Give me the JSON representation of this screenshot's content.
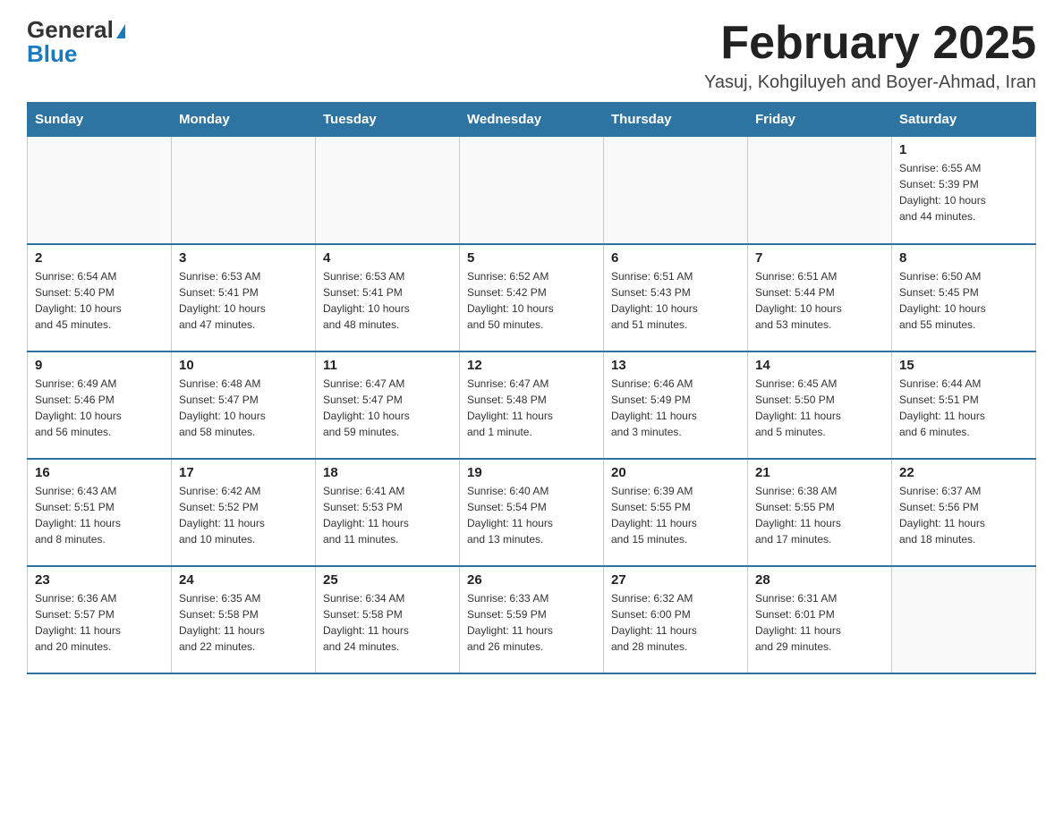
{
  "logo": {
    "general": "General",
    "blue": "Blue"
  },
  "title": "February 2025",
  "subtitle": "Yasuj, Kohgiluyeh and Boyer-Ahmad, Iran",
  "days_header": [
    "Sunday",
    "Monday",
    "Tuesday",
    "Wednesday",
    "Thursday",
    "Friday",
    "Saturday"
  ],
  "weeks": [
    [
      {
        "num": "",
        "info": ""
      },
      {
        "num": "",
        "info": ""
      },
      {
        "num": "",
        "info": ""
      },
      {
        "num": "",
        "info": ""
      },
      {
        "num": "",
        "info": ""
      },
      {
        "num": "",
        "info": ""
      },
      {
        "num": "1",
        "info": "Sunrise: 6:55 AM\nSunset: 5:39 PM\nDaylight: 10 hours\nand 44 minutes."
      }
    ],
    [
      {
        "num": "2",
        "info": "Sunrise: 6:54 AM\nSunset: 5:40 PM\nDaylight: 10 hours\nand 45 minutes."
      },
      {
        "num": "3",
        "info": "Sunrise: 6:53 AM\nSunset: 5:41 PM\nDaylight: 10 hours\nand 47 minutes."
      },
      {
        "num": "4",
        "info": "Sunrise: 6:53 AM\nSunset: 5:41 PM\nDaylight: 10 hours\nand 48 minutes."
      },
      {
        "num": "5",
        "info": "Sunrise: 6:52 AM\nSunset: 5:42 PM\nDaylight: 10 hours\nand 50 minutes."
      },
      {
        "num": "6",
        "info": "Sunrise: 6:51 AM\nSunset: 5:43 PM\nDaylight: 10 hours\nand 51 minutes."
      },
      {
        "num": "7",
        "info": "Sunrise: 6:51 AM\nSunset: 5:44 PM\nDaylight: 10 hours\nand 53 minutes."
      },
      {
        "num": "8",
        "info": "Sunrise: 6:50 AM\nSunset: 5:45 PM\nDaylight: 10 hours\nand 55 minutes."
      }
    ],
    [
      {
        "num": "9",
        "info": "Sunrise: 6:49 AM\nSunset: 5:46 PM\nDaylight: 10 hours\nand 56 minutes."
      },
      {
        "num": "10",
        "info": "Sunrise: 6:48 AM\nSunset: 5:47 PM\nDaylight: 10 hours\nand 58 minutes."
      },
      {
        "num": "11",
        "info": "Sunrise: 6:47 AM\nSunset: 5:47 PM\nDaylight: 10 hours\nand 59 minutes."
      },
      {
        "num": "12",
        "info": "Sunrise: 6:47 AM\nSunset: 5:48 PM\nDaylight: 11 hours\nand 1 minute."
      },
      {
        "num": "13",
        "info": "Sunrise: 6:46 AM\nSunset: 5:49 PM\nDaylight: 11 hours\nand 3 minutes."
      },
      {
        "num": "14",
        "info": "Sunrise: 6:45 AM\nSunset: 5:50 PM\nDaylight: 11 hours\nand 5 minutes."
      },
      {
        "num": "15",
        "info": "Sunrise: 6:44 AM\nSunset: 5:51 PM\nDaylight: 11 hours\nand 6 minutes."
      }
    ],
    [
      {
        "num": "16",
        "info": "Sunrise: 6:43 AM\nSunset: 5:51 PM\nDaylight: 11 hours\nand 8 minutes."
      },
      {
        "num": "17",
        "info": "Sunrise: 6:42 AM\nSunset: 5:52 PM\nDaylight: 11 hours\nand 10 minutes."
      },
      {
        "num": "18",
        "info": "Sunrise: 6:41 AM\nSunset: 5:53 PM\nDaylight: 11 hours\nand 11 minutes."
      },
      {
        "num": "19",
        "info": "Sunrise: 6:40 AM\nSunset: 5:54 PM\nDaylight: 11 hours\nand 13 minutes."
      },
      {
        "num": "20",
        "info": "Sunrise: 6:39 AM\nSunset: 5:55 PM\nDaylight: 11 hours\nand 15 minutes."
      },
      {
        "num": "21",
        "info": "Sunrise: 6:38 AM\nSunset: 5:55 PM\nDaylight: 11 hours\nand 17 minutes."
      },
      {
        "num": "22",
        "info": "Sunrise: 6:37 AM\nSunset: 5:56 PM\nDaylight: 11 hours\nand 18 minutes."
      }
    ],
    [
      {
        "num": "23",
        "info": "Sunrise: 6:36 AM\nSunset: 5:57 PM\nDaylight: 11 hours\nand 20 minutes."
      },
      {
        "num": "24",
        "info": "Sunrise: 6:35 AM\nSunset: 5:58 PM\nDaylight: 11 hours\nand 22 minutes."
      },
      {
        "num": "25",
        "info": "Sunrise: 6:34 AM\nSunset: 5:58 PM\nDaylight: 11 hours\nand 24 minutes."
      },
      {
        "num": "26",
        "info": "Sunrise: 6:33 AM\nSunset: 5:59 PM\nDaylight: 11 hours\nand 26 minutes."
      },
      {
        "num": "27",
        "info": "Sunrise: 6:32 AM\nSunset: 6:00 PM\nDaylight: 11 hours\nand 28 minutes."
      },
      {
        "num": "28",
        "info": "Sunrise: 6:31 AM\nSunset: 6:01 PM\nDaylight: 11 hours\nand 29 minutes."
      },
      {
        "num": "",
        "info": ""
      }
    ]
  ]
}
